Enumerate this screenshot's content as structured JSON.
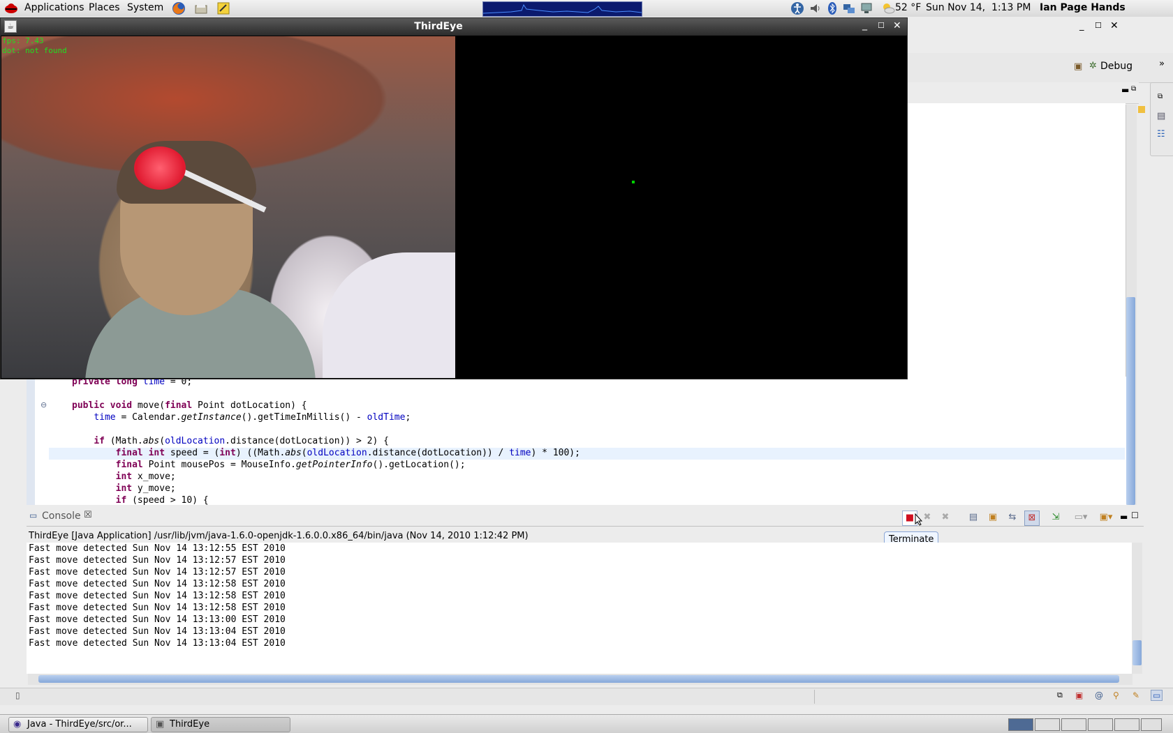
{
  "top_panel": {
    "menus": [
      "Applications",
      "Places",
      "System"
    ],
    "weather": "52 °F",
    "clock": "Sun Nov 14,  1:13 PM",
    "user": "Ian Page Hands",
    "icons": [
      "redhat-icon",
      "firefox-icon",
      "notes-icon",
      "tomboy-icon",
      "system-monitor",
      "accessibility-icon",
      "volume-icon",
      "bluetooth-icon",
      "network-icon",
      "display-icon",
      "weather-icon"
    ]
  },
  "eclipse": {
    "perspective_debug_label": "Debug",
    "code_lines": [
      {
        "text": "private long time = 0;"
      },
      {
        "text": ""
      },
      {
        "text": "public void move(final Point dotLocation) {"
      },
      {
        "text": "    time = Calendar.getInstance().getTimeInMillis() - oldTime;"
      },
      {
        "text": ""
      },
      {
        "text": "    if (Math.abs(oldLocation.distance(dotLocation)) > 2) {"
      },
      {
        "text": "        final int speed = (int) ((Math.abs(oldLocation.distance(dotLocation)) / time) * 100);"
      },
      {
        "text": "        final Point mousePos = MouseInfo.getPointerInfo().getLocation();"
      },
      {
        "text": "        int x_move;"
      },
      {
        "text": "        int y_move;"
      },
      {
        "text": "        if (speed > 10) {"
      }
    ],
    "console": {
      "tab_label": "Console",
      "description": "ThirdEye [Java Application] /usr/lib/jvm/java-1.6.0-openjdk-1.6.0.0.x86_64/bin/java (Nov 14, 2010 1:12:42 PM)",
      "tooltip": "Terminate",
      "lines": [
        "Fast move detected Sun Nov 14 13:12:55 EST 2010",
        "Fast move detected Sun Nov 14 13:12:57 EST 2010",
        "Fast move detected Sun Nov 14 13:12:57 EST 2010",
        "Fast move detected Sun Nov 14 13:12:58 EST 2010",
        "Fast move detected Sun Nov 14 13:12:58 EST 2010",
        "Fast move detected Sun Nov 14 13:12:58 EST 2010",
        "Fast move detected Sun Nov 14 13:13:00 EST 2010",
        "Fast move detected Sun Nov 14 13:13:04 EST 2010",
        "Fast move detected Sun Nov 14 13:13:04 EST 2010"
      ]
    }
  },
  "thirdeye": {
    "title": "ThirdEye",
    "overlay_line1": "fps: 7.43",
    "overlay_line2": "dot: not found"
  },
  "taskbar": {
    "tasks": [
      "Java - ThirdEye/src/or...",
      "ThirdEye"
    ]
  }
}
